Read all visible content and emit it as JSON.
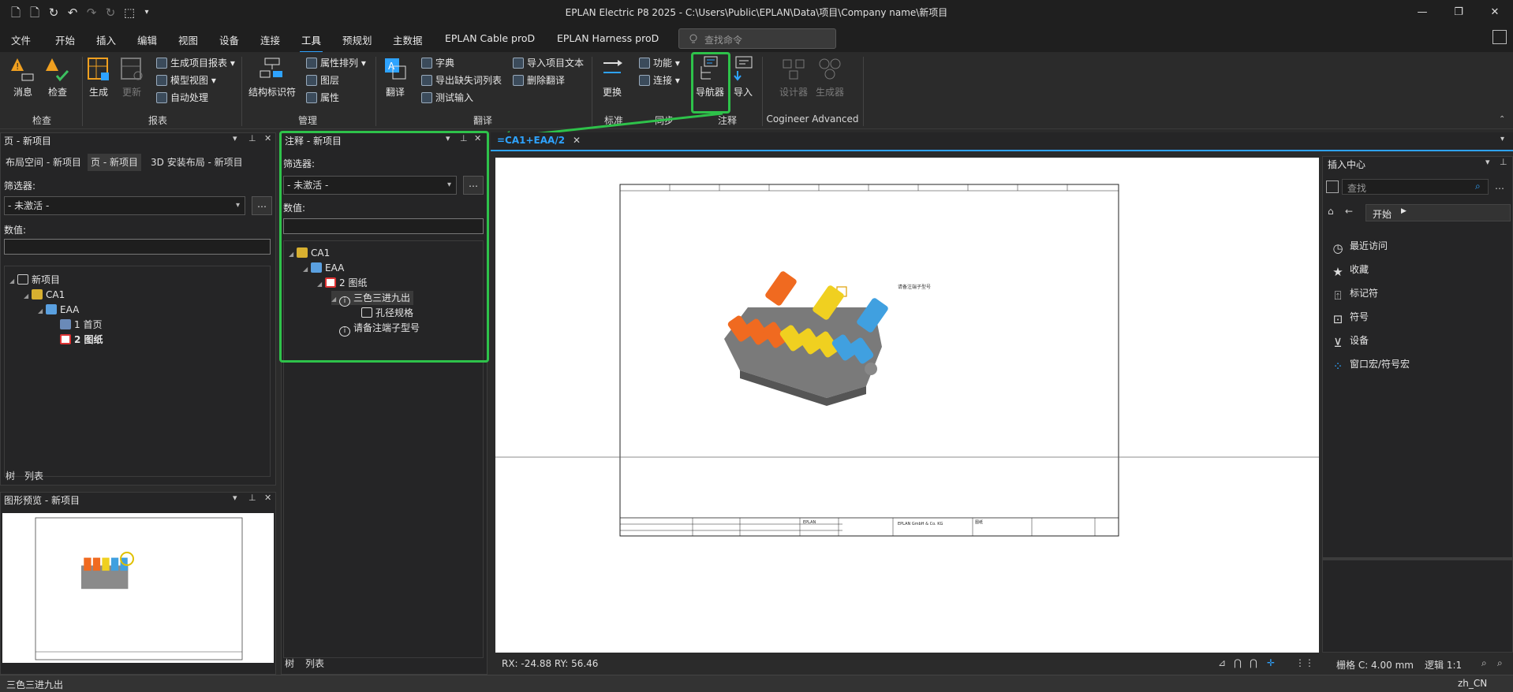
{
  "window": {
    "title": "EPLAN Electric P8 2025 - C:\\Users\\Public\\EPLAN\\Data\\项目\\Company name\\新项目"
  },
  "menu": [
    "文件",
    "开始",
    "插入",
    "编辑",
    "视图",
    "设备",
    "连接",
    "工具",
    "预规划",
    "主数据",
    "EPLAN Cable proD",
    "EPLAN Harness proD"
  ],
  "menu_active": "工具",
  "command_search": {
    "placeholder": "查找命令"
  },
  "ribbon": {
    "check": {
      "msg": "消息",
      "check": "检查",
      "group": "检查"
    },
    "report": {
      "generate": "生成",
      "update": "更新",
      "gen_report": "生成项目报表",
      "model_view": "模型视图",
      "auto_process": "自动处理",
      "group": "报表"
    },
    "manage": {
      "struct_id": "结构标识符",
      "prop_sort": "属性排列",
      "layer": "图层",
      "property": "属性",
      "group": "管理"
    },
    "translate": {
      "translate": "翻译",
      "dict": "字典",
      "export_missing": "导出缺失词列表",
      "test_input": "测试输入",
      "import_text": "导入项目文本",
      "delete_translation": "删除翻译",
      "group": "翻译"
    },
    "std": {
      "replace": "更换",
      "function": "功能",
      "connect": "连接",
      "group1": "标准",
      "group2": "同步"
    },
    "annot": {
      "navigator": "导航器",
      "import": "导入",
      "group": "注释"
    },
    "cogineer": {
      "designer": "设计器",
      "generator": "生成器",
      "group": "Cogineer Advanced"
    }
  },
  "page_panel": {
    "title": "页 - 新项目",
    "tabs": [
      "布局空间 - 新项目",
      "页 - 新项目",
      "3D 安装布局 - 新项目"
    ],
    "filter_label": "筛选器:",
    "filter_value": "- 未激活 -",
    "value_label": "数值:",
    "tree": [
      "新项目",
      "CA1",
      "EAA",
      "1 首页",
      "2 图纸"
    ],
    "bottom_tabs": [
      "树",
      "列表"
    ]
  },
  "preview_panel": {
    "title": "图形预览 - 新项目"
  },
  "annot_panel": {
    "title": "注释 - 新项目",
    "filter_label": "筛选器:",
    "filter_value": "- 未激活 -",
    "value_label": "数值:",
    "tree": [
      "CA1",
      "EAA",
      "2 图纸",
      "三色三进九出",
      "孔径规格",
      "请备注端子型号"
    ],
    "bottom_tabs": [
      "树",
      "列表"
    ]
  },
  "doc_tab": {
    "label": "=CA1+EAA/2"
  },
  "drawing": {
    "note": "请备注端子型号"
  },
  "insert_center": {
    "title": "插入中心",
    "search_placeholder": "查找",
    "crumb": "开始",
    "items": [
      "最近访问",
      "收藏",
      "标记符",
      "符号",
      "设备",
      "窗口宏/符号宏"
    ]
  },
  "canvas_status": {
    "coords": "RX: -24.88 RY: 56.46",
    "grid": "栅格 C: 4.00 mm",
    "logic": "逻辑 1:1"
  },
  "status": {
    "left": "三色三进九出",
    "right": "zh_CN"
  },
  "colors": {
    "highlight": "#2ec24a",
    "accent": "#2ea3ff"
  }
}
